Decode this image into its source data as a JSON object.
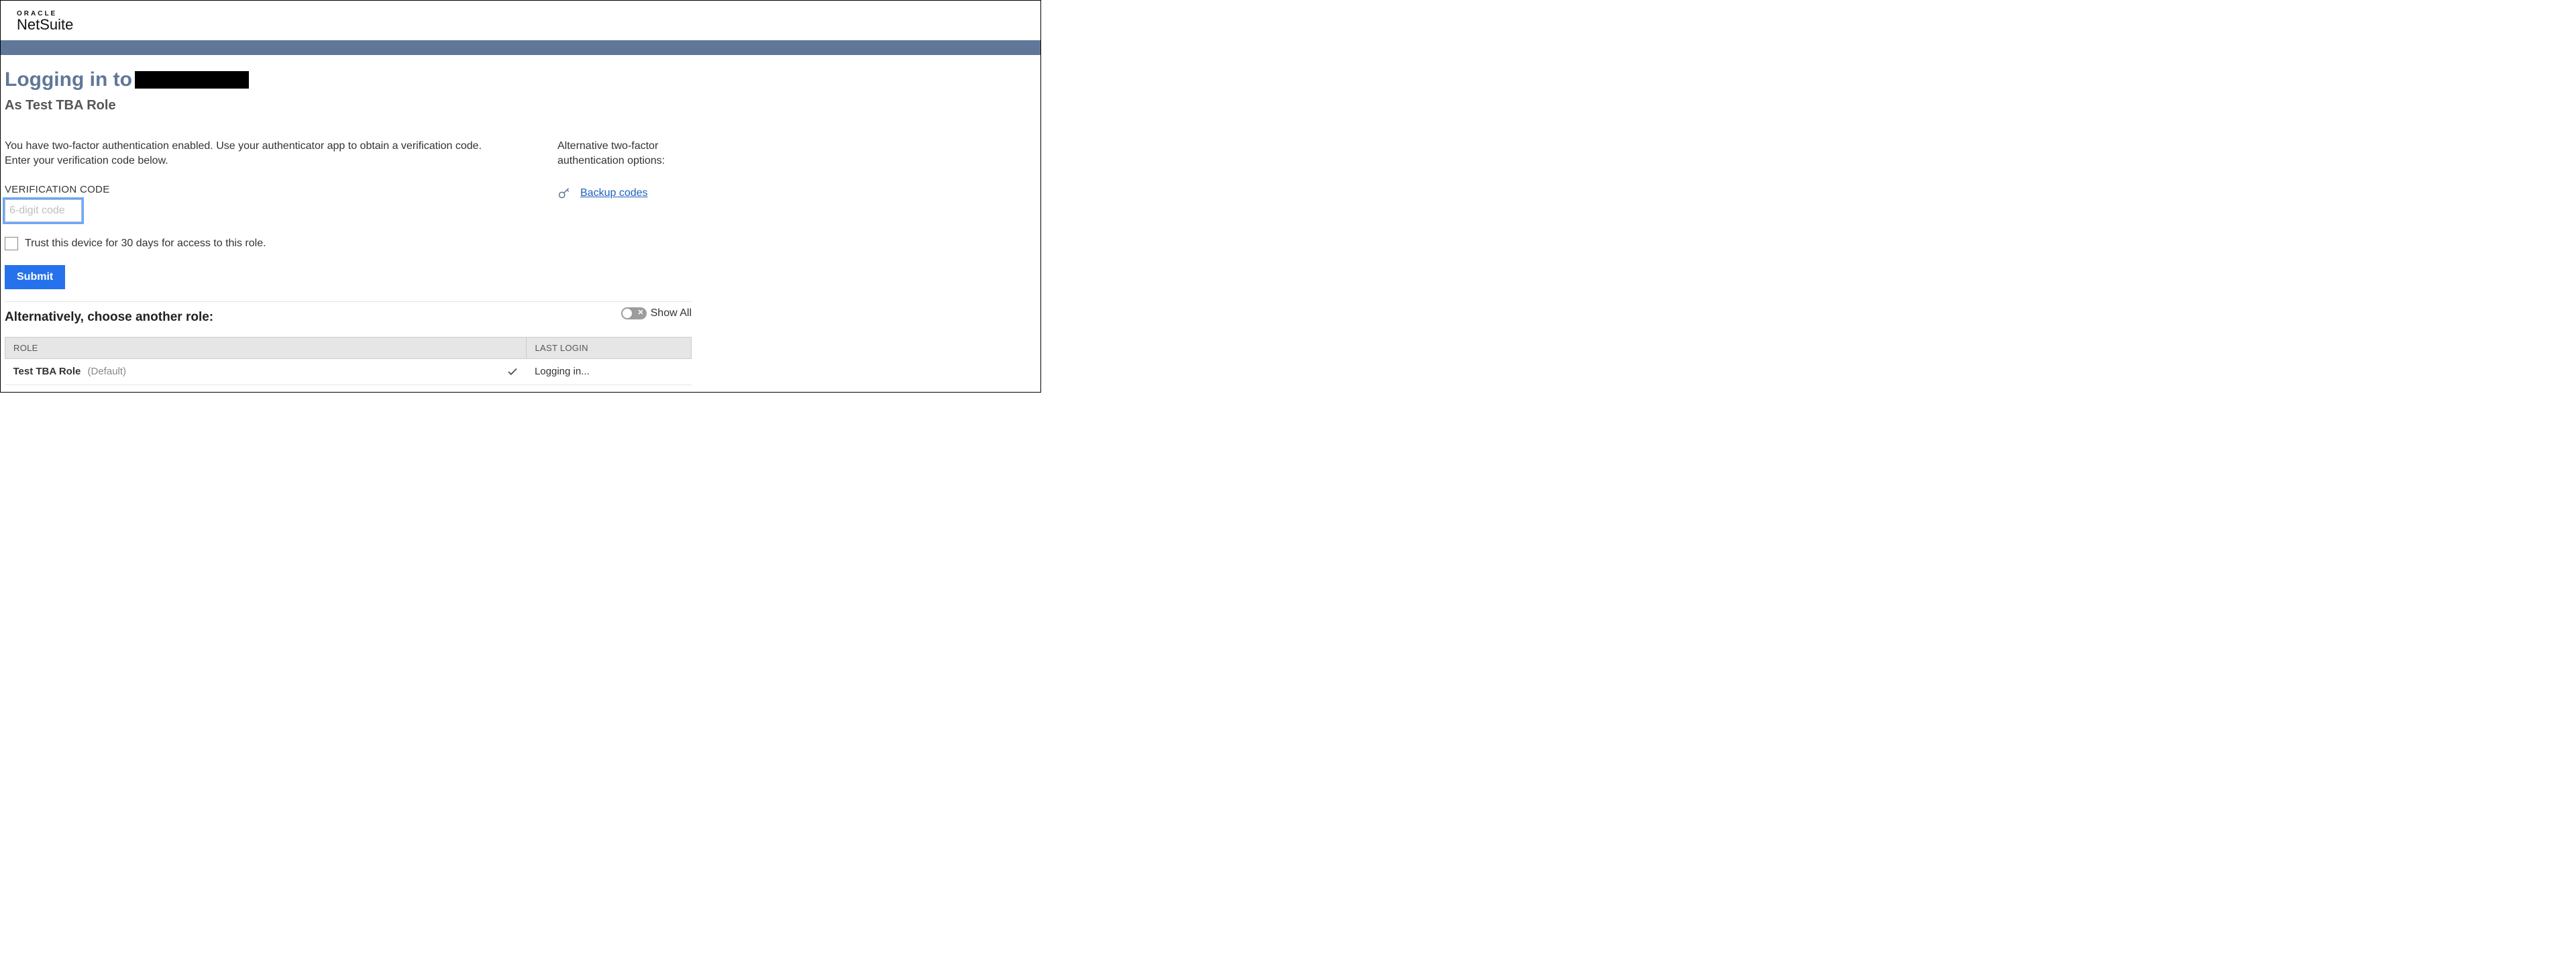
{
  "logo": {
    "top": "ORACLE",
    "bottom_net": "Net",
    "bottom_suite": "Suite"
  },
  "header": {
    "title_prefix": "Logging in to",
    "subtitle": "As Test TBA Role"
  },
  "main": {
    "description": "You have two-factor authentication enabled. Use your authenticator app to obtain a verification code. Enter your verification code below.",
    "field_label": "VERIFICATION CODE",
    "placeholder": "6-digit code",
    "trust_label": "Trust this device for 30 days for access to this role.",
    "submit_label": "Submit"
  },
  "alt_options": {
    "heading": "Alternative two-factor authentication options:",
    "backup_link": "Backup codes"
  },
  "roles_section": {
    "heading": "Alternatively, choose another role:",
    "show_all_label": "Show All",
    "columns": {
      "role": "ROLE",
      "last_login": "LAST LOGIN"
    },
    "rows": [
      {
        "name": "Test TBA Role",
        "default_suffix": "(Default)",
        "last_login": "Logging in...",
        "current": true
      }
    ]
  }
}
